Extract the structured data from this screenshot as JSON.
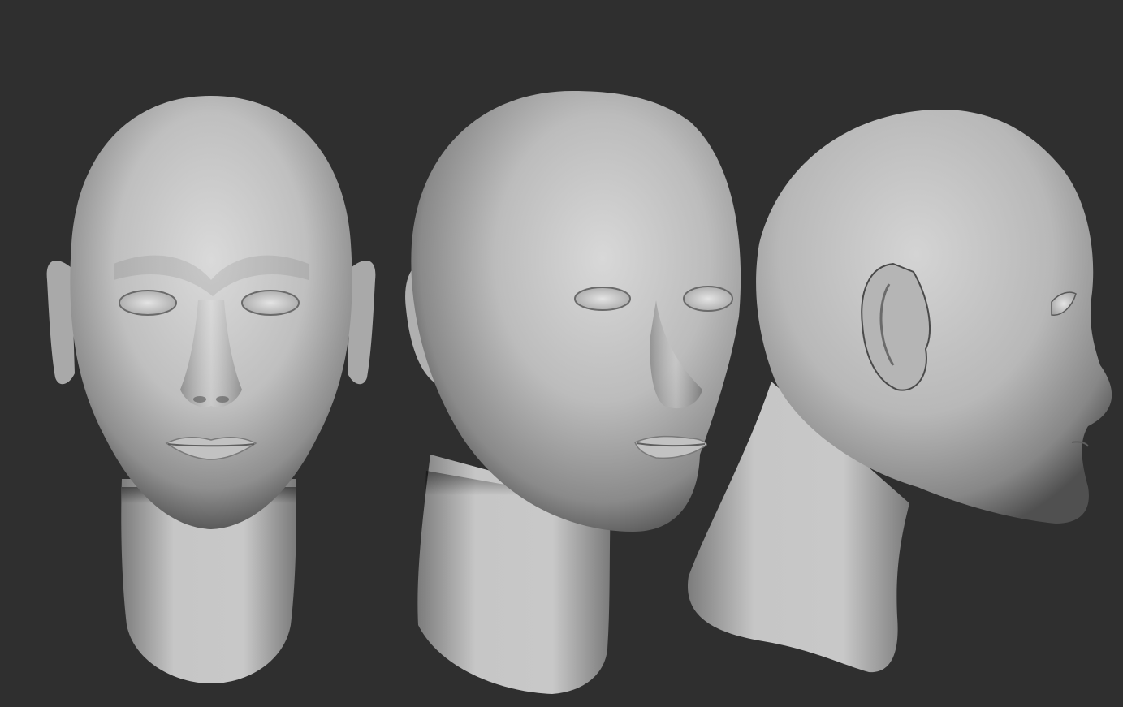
{
  "scene": {
    "background_color": "#2f2f2f",
    "material_base_color": "#b9b9b9",
    "material_highlight_color": "#e2e2e2",
    "material_shadow_color": "#555555",
    "views": [
      {
        "id": "front"
      },
      {
        "id": "three-quarter"
      },
      {
        "id": "side"
      }
    ]
  }
}
